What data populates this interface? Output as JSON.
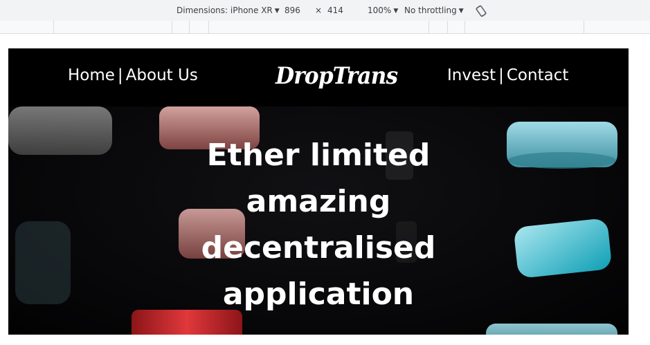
{
  "devtools": {
    "dimensions_label": "Dimensions: iPhone XR",
    "width": "896",
    "times": "×",
    "height": "414",
    "zoom": "100%",
    "throttling": "No throttling",
    "icons": [
      "caret-down-icon",
      "rotate-icon"
    ]
  },
  "site": {
    "nav_left": [
      {
        "label": "Home"
      },
      {
        "label": "About Us"
      }
    ],
    "nav_right": [
      {
        "label": "Invest"
      },
      {
        "label": "Contact"
      }
    ],
    "separator": "|",
    "logo": "DropTrans",
    "hero_title": "Ether limited amazing decentralised application"
  },
  "colors": {
    "page_background": "#050507",
    "nav_background": "#000000",
    "text": "#ffffff",
    "shape_red": "#c8262b",
    "shape_pink": "#e7a7a3",
    "shape_teal": "#6ec8d8",
    "shape_cyan": "#16b3c8"
  }
}
